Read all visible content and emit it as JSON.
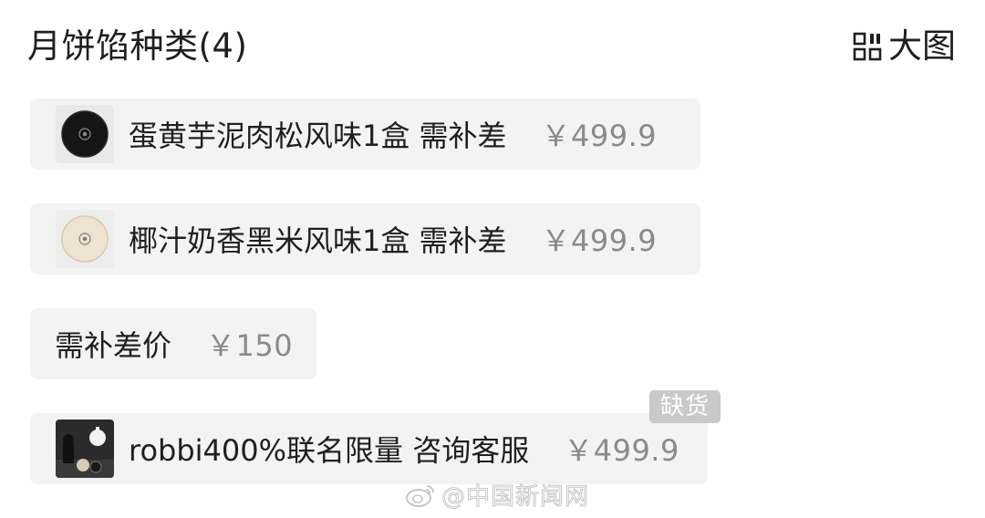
{
  "section": {
    "title": "月饼馅种类(4)",
    "view_toggle_label": "大图",
    "view_toggle_icon": "grid-icon"
  },
  "options": [
    {
      "name": "蛋黄芋泥肉松风味1盒 需补差",
      "price": "￥499.9",
      "thumbnail": "black-mooncake-box-thumbnail"
    },
    {
      "name": "椰汁奶香黑米风味1盒 需补差",
      "price": "￥499.9",
      "thumbnail": "white-mooncake-box-thumbnail"
    },
    {
      "name": "需补差价",
      "price": "￥150"
    },
    {
      "name": "robbi400%联名限量 咨询客服",
      "price": "￥499.9",
      "thumbnail": "robbi-figure-thumbnail",
      "badge": "缺货"
    }
  ],
  "watermark": {
    "text": "@中国新闻网",
    "icon": "weibo-icon"
  },
  "colors": {
    "option_background": "#f3f3f3",
    "price_text": "#8a8a8a",
    "badge_background": "#c9c9c9"
  }
}
